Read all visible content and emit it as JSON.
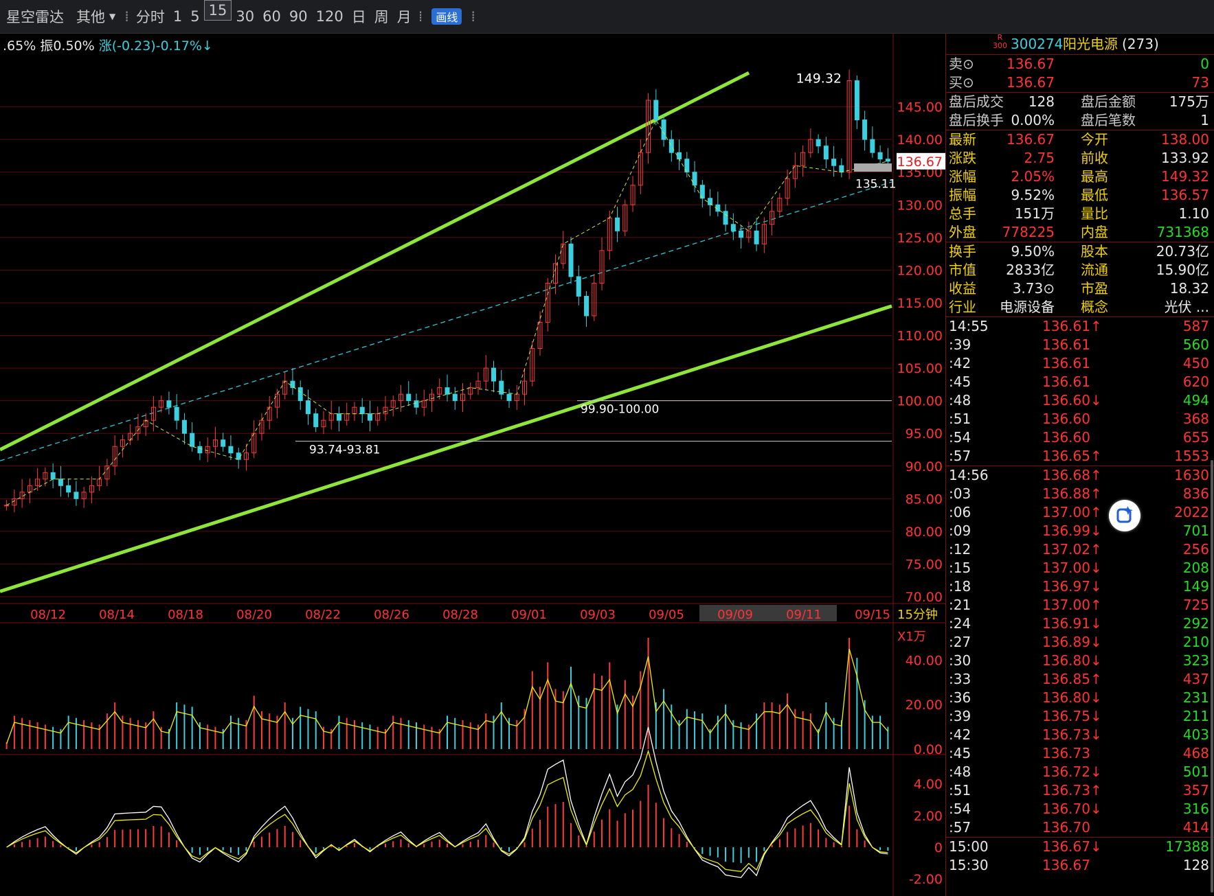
{
  "toolbar": {
    "app_label": "星空雷达",
    "other_label": "其他",
    "periods": [
      "分时",
      "1",
      "5",
      "15",
      "30",
      "60",
      "90",
      "120",
      "日",
      "周",
      "月"
    ],
    "active_period": "15",
    "draw_button": "画线"
  },
  "chart_info": {
    "pct": ".65%",
    "amp": "振0.50%",
    "change": "涨(-0.23)-0.17%↓"
  },
  "period_label": "15分钟",
  "volume_unit": "X1万",
  "chart_data": {
    "type": "candlestick",
    "price_axis": [
      "145.00",
      "140.00",
      "135.00",
      "130.00",
      "125.00",
      "120.00",
      "115.00",
      "110.00",
      "105.00",
      "100.00",
      "95.00",
      "90.00",
      "85.00",
      "80.00",
      "75.00",
      "70.00"
    ],
    "ylim": [
      70,
      152
    ],
    "dates": [
      "08/12",
      "08/14",
      "08/18",
      "08/20",
      "08/22",
      "08/26",
      "08/28",
      "09/01",
      "09/03",
      "09/05",
      "09/09",
      "09/11",
      "09/15"
    ],
    "highlighted_date": "09/09",
    "close_path": [
      84,
      85,
      86,
      87,
      88,
      89,
      88,
      87,
      86,
      85,
      86,
      87,
      88,
      90,
      93,
      94,
      95,
      96,
      97,
      99,
      100,
      99,
      97,
      95,
      93,
      92,
      93,
      94,
      93,
      92,
      91,
      92,
      95,
      97,
      99,
      101,
      103,
      102,
      100,
      98,
      96,
      97,
      98,
      97,
      98,
      99,
      98,
      97,
      98,
      99,
      100,
      101,
      100,
      99,
      100,
      101,
      102,
      101,
      100,
      101,
      102,
      103,
      105,
      103,
      101,
      100,
      101,
      103,
      108,
      112,
      118,
      121,
      124,
      119,
      116,
      113,
      118,
      123,
      128,
      126,
      130,
      133,
      138,
      146,
      143,
      140,
      138,
      137,
      135,
      133,
      131,
      130,
      129,
      127,
      126,
      125,
      126,
      124,
      127,
      129,
      131,
      134,
      136,
      138,
      140,
      139,
      137,
      136,
      135,
      149,
      143,
      140,
      138,
      137,
      136.67
    ],
    "markers": {
      "current_price": "136.67",
      "peak_label": "149.32",
      "low_label": "135.11",
      "level_1": "99.90-100.00",
      "level_2": "93.74-93.81"
    },
    "volume_axis": [
      "40.00",
      "20.00",
      "0.00"
    ],
    "macd_axis": [
      "4.00",
      "2.00",
      "0",
      "-2.00"
    ]
  },
  "quote": {
    "code_prefix": "R",
    "code_prefix2": "300",
    "code": "300274",
    "name": "阳光电源",
    "count": "(273)",
    "sell": {
      "label": "卖⊙",
      "price": "136.67",
      "vol": "0"
    },
    "buy": {
      "label": "买⊙",
      "price": "136.67",
      "vol": "73"
    },
    "after": [
      {
        "l1": "盘后成交",
        "v1": "128",
        "l2": "盘后金额",
        "v2": "175万"
      },
      {
        "l1": "盘后换手",
        "v1": "0.00%",
        "l2": "盘后笔数",
        "v2": "1"
      }
    ],
    "stats": [
      {
        "l1": "最新",
        "v1": "136.67",
        "c1": "red",
        "l2": "今开",
        "v2": "138.00",
        "c2": "red"
      },
      {
        "l1": "涨跌",
        "v1": "2.75",
        "c1": "red",
        "l2": "前收",
        "v2": "133.92",
        "c2": "wht"
      },
      {
        "l1": "涨幅",
        "v1": "2.05%",
        "c1": "red",
        "l2": "最高",
        "v2": "149.32",
        "c2": "red"
      },
      {
        "l1": "振幅",
        "v1": "9.52%",
        "c1": "wht",
        "l2": "最低",
        "v2": "136.57",
        "c2": "red"
      },
      {
        "l1": "总手",
        "v1": "151万",
        "c1": "wht",
        "l2": "量比",
        "v2": "1.10",
        "c2": "wht"
      },
      {
        "l1": "外盘",
        "v1": "778225",
        "c1": "red",
        "l2": "内盘",
        "v2": "731368",
        "c2": "grn"
      }
    ],
    "fund": [
      {
        "l1": "换手",
        "v1": "9.50%",
        "l2": "股本",
        "v2": "20.73亿"
      },
      {
        "l1": "市值",
        "v1": "2833亿",
        "l2": "流通",
        "v2": "15.90亿"
      },
      {
        "l1": "收益",
        "v1": "3.73⊙",
        "l2": "市盈",
        "v2": "18.32"
      }
    ],
    "industry": {
      "l1": "行业",
      "v1": "电源设备",
      "l2": "概念",
      "v2": "光伏 ..."
    },
    "ticks": [
      {
        "t": "14:55",
        "p": "136.61↑",
        "v": "587",
        "vc": "red"
      },
      {
        "t": ":39",
        "p": "136.61",
        "v": "560",
        "vc": "grn"
      },
      {
        "t": ":42",
        "p": "136.61",
        "v": "450",
        "vc": "red"
      },
      {
        "t": ":45",
        "p": "136.61",
        "v": "620",
        "vc": "red"
      },
      {
        "t": ":48",
        "p": "136.60↓",
        "v": "494",
        "vc": "grn"
      },
      {
        "t": ":51",
        "p": "136.60",
        "v": "368",
        "vc": "red"
      },
      {
        "t": ":54",
        "p": "136.60",
        "v": "655",
        "vc": "red"
      },
      {
        "t": ":57",
        "p": "136.65↑",
        "v": "1553",
        "vc": "red"
      },
      {
        "t": "14:56",
        "p": "136.68↑",
        "v": "1630",
        "vc": "red"
      },
      {
        "t": ":03",
        "p": "136.88↑",
        "v": "836",
        "vc": "red"
      },
      {
        "t": ":06",
        "p": "137.00↑",
        "v": "2022",
        "vc": "red"
      },
      {
        "t": ":09",
        "p": "136.99↓",
        "v": "701",
        "vc": "grn"
      },
      {
        "t": ":12",
        "p": "137.02↑",
        "v": "256",
        "vc": "red"
      },
      {
        "t": ":15",
        "p": "137.00↓",
        "v": "208",
        "vc": "grn"
      },
      {
        "t": ":18",
        "p": "136.97↓",
        "v": "149",
        "vc": "grn"
      },
      {
        "t": ":21",
        "p": "137.00↑",
        "v": "725",
        "vc": "red"
      },
      {
        "t": ":24",
        "p": "136.91↓",
        "v": "292",
        "vc": "grn"
      },
      {
        "t": ":27",
        "p": "136.89↓",
        "v": "210",
        "vc": "grn"
      },
      {
        "t": ":30",
        "p": "136.80↓",
        "v": "323",
        "vc": "grn"
      },
      {
        "t": ":33",
        "p": "136.85↑",
        "v": "437",
        "vc": "red"
      },
      {
        "t": ":36",
        "p": "136.80↓",
        "v": "231",
        "vc": "grn"
      },
      {
        "t": ":39",
        "p": "136.75↓",
        "v": "211",
        "vc": "grn"
      },
      {
        "t": ":42",
        "p": "136.73↓",
        "v": "403",
        "vc": "grn"
      },
      {
        "t": ":45",
        "p": "136.73",
        "v": "468",
        "vc": "red"
      },
      {
        "t": ":48",
        "p": "136.72↓",
        "v": "501",
        "vc": "grn"
      },
      {
        "t": ":51",
        "p": "136.73↑",
        "v": "357",
        "vc": "red"
      },
      {
        "t": ":54",
        "p": "136.70↓",
        "v": "316",
        "vc": "grn"
      },
      {
        "t": ":57",
        "p": "136.70",
        "v": "414",
        "vc": "red"
      },
      {
        "t": "15:00",
        "p": "136.67↓",
        "v": "17388",
        "vc": "grn"
      },
      {
        "t": "15:30",
        "p": "136.67",
        "v": "128",
        "vc": "wht"
      }
    ]
  }
}
